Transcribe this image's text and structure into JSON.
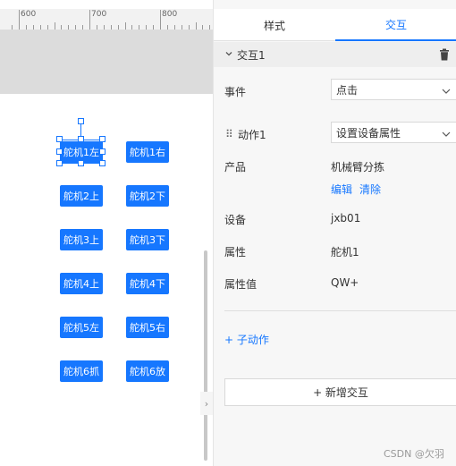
{
  "ruler": {
    "labels": [
      "600",
      "700",
      "800"
    ]
  },
  "canvas": {
    "buttons": [
      "舵机1左",
      "舵机1右",
      "舵机2上",
      "舵机2下",
      "舵机3上",
      "舵机3下",
      "舵机4上",
      "舵机4下",
      "舵机5左",
      "舵机5右",
      "舵机6抓",
      "舵机6放"
    ]
  },
  "panel": {
    "tabs": [
      {
        "label": "样式"
      },
      {
        "label": "交互"
      }
    ],
    "active_tab": "交互",
    "interaction": {
      "title": "交互1",
      "event_label": "事件",
      "event_value": "点击",
      "action_label": "动作1",
      "action_value": "设置设备属性",
      "product_label": "产品",
      "product_value": "机械臂分拣",
      "edit_link": "编辑",
      "clear_link": "清除",
      "device_label": "设备",
      "device_value": "jxb01",
      "property_label": "属性",
      "property_value": "舵机1",
      "property_value_label": "属性值",
      "property_value_value": "QW+",
      "sub_action": "+ 子动作"
    },
    "add_interaction": "+ 新增交互"
  },
  "watermark": "CSDN @欠羽",
  "colors": {
    "accent": "#1677ff",
    "panel_bg": "#f7f7f7",
    "ruler_bg": "#f2f2f2"
  }
}
